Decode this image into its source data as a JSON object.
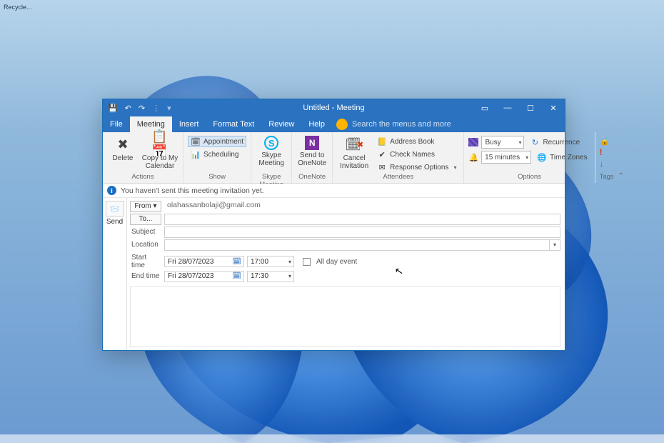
{
  "desktop": {
    "icon1": "Recycle...",
    "icon2": ""
  },
  "titlebar": {
    "title": "Untitled  -  Meeting"
  },
  "menu": {
    "file": "File",
    "meeting": "Meeting",
    "insert": "Insert",
    "format_text": "Format Text",
    "review": "Review",
    "help": "Help",
    "search_placeholder": "Search the menus and more"
  },
  "ribbon": {
    "actions": {
      "label": "Actions",
      "delete": "Delete",
      "copy": "Copy to My\nCalendar"
    },
    "show": {
      "label": "Show",
      "appointment": "Appointment",
      "scheduling": "Scheduling"
    },
    "skype": {
      "label": "Skype Meeting",
      "btn": "Skype\nMeeting"
    },
    "onenote": {
      "label": "OneNote",
      "btn": "Send to\nOneNote"
    },
    "attendees": {
      "label": "Attendees",
      "cancel": "Cancel\nInvitation",
      "address": "Address Book",
      "check": "Check Names",
      "response": "Response Options"
    },
    "options": {
      "label": "Options",
      "busy": "Busy",
      "reminder": "15 minutes",
      "recurrence": "Recurrence",
      "timezones": "Time Zones"
    },
    "tags": {
      "label": "Tags"
    }
  },
  "infobar": {
    "text": "You haven't sent this meeting invitation yet."
  },
  "form": {
    "send": "Send",
    "from_label": "From ▾",
    "from_value": "olahassanbolaji@gmail.com",
    "to_label": "To...",
    "to_value": "",
    "subject_label": "Subject",
    "subject_value": "",
    "location_label": "Location",
    "location_value": "",
    "start_label": "Start time",
    "start_date": "Fri 28/07/2023",
    "start_time": "17:00",
    "end_label": "End time",
    "end_date": "Fri 28/07/2023",
    "end_time": "17:30",
    "allday": "All day event"
  }
}
